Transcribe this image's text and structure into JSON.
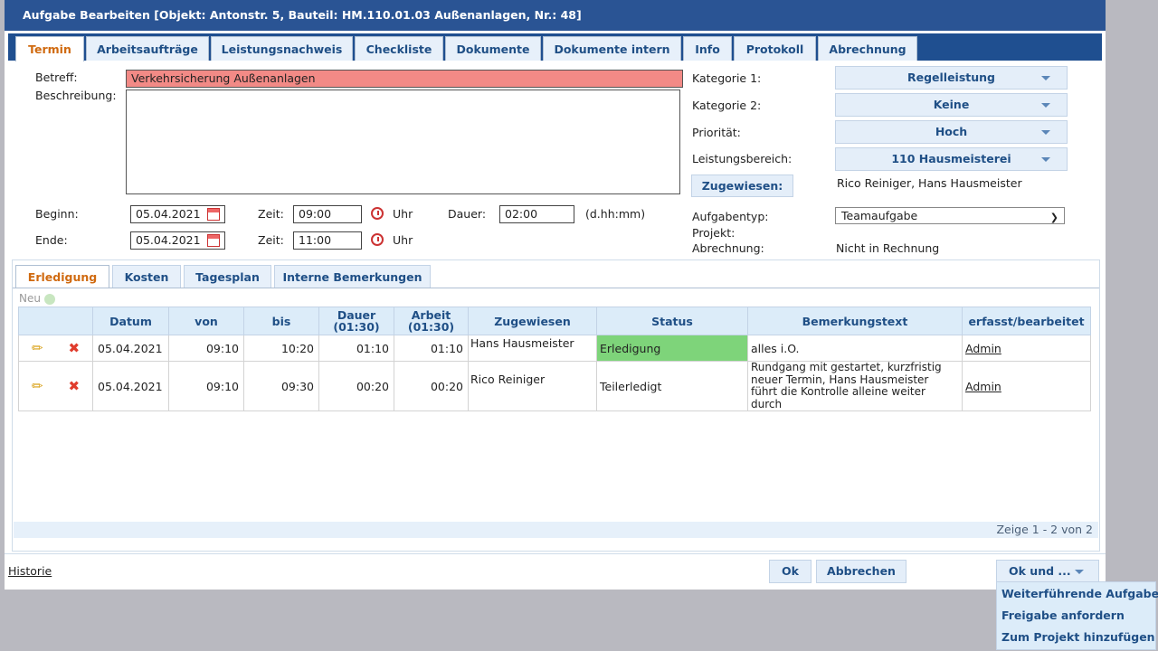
{
  "window": {
    "title": "Aufgabe Bearbeiten [Objekt: Antonstr. 5, Bauteil: HM.110.01.03 Außenanlagen, Nr.: 48]"
  },
  "tabs": [
    "Termin",
    "Arbeitsaufträge",
    "Leistungsnachweis",
    "Checkliste",
    "Dokumente",
    "Dokumente intern",
    "Info",
    "Protokoll",
    "Abrechnung"
  ],
  "form": {
    "betreff_label": "Betreff:",
    "betreff_value": "Verkehrsicherung Außenanlagen",
    "beschreibung_label": "Beschreibung:",
    "beginn_label": "Beginn:",
    "beginn_value": "05.04.2021",
    "ende_label": "Ende:",
    "ende_value": "05.04.2021",
    "zeit_label": "Zeit:",
    "zeit_begin": "09:00",
    "zeit_end": "11:00",
    "uhr_label": "Uhr",
    "dauer_label": "Dauer:",
    "dauer_value": "02:00",
    "dauer_hint": "(d.hh:mm)"
  },
  "right": {
    "kategorie1_label": "Kategorie 1:",
    "kategorie1_value": "Regelleistung",
    "kategorie2_label": "Kategorie 2:",
    "kategorie2_value": "Keine",
    "prioritaet_label": "Priorität:",
    "prioritaet_value": "Hoch",
    "leistungsbereich_label": "Leistungsbereich:",
    "leistungsbereich_value": "110 Hausmeisterei",
    "zugewiesen_button": "Zugewiesen:",
    "zugewiesen_value": "Rico Reiniger, Hans Hausmeister",
    "aufgabentyp_label": "Aufgabentyp:",
    "aufgabentyp_value": "Teamaufgabe",
    "projekt_label": "Projekt:",
    "abrechnung_label": "Abrechnung:",
    "abrechnung_value": "Nicht in Rechnung"
  },
  "subtabs": [
    "Erledigung",
    "Kosten",
    "Tagesplan",
    "Interne Bemerkungen"
  ],
  "grid": {
    "new_label": "Neu",
    "headers": {
      "datum": "Datum",
      "von": "von",
      "bis": "bis",
      "dauer": "Dauer",
      "dauer_sub": "(01:30)",
      "arbeit": "Arbeit",
      "arbeit_sub": "(01:30)",
      "zugewiesen": "Zugewiesen",
      "status": "Status",
      "bemerkung": "Bemerkungstext",
      "erfasst": "erfasst/bearbeitet"
    },
    "rows": [
      {
        "datum": "05.04.2021",
        "von": "09:10",
        "bis": "10:20",
        "dauer": "01:10",
        "arbeit": "01:10",
        "zugewiesen": "Hans Hausmeister",
        "status": "Erledigung",
        "bemerkung": "alles i.O.",
        "erfasst": "Admin"
      },
      {
        "datum": "05.04.2021",
        "von": "09:10",
        "bis": "09:30",
        "dauer": "00:20",
        "arbeit": "00:20",
        "zugewiesen": "Rico Reiniger",
        "status": "Teilerledigt",
        "bemerkung": "Rundgang mit gestartet, kurzfristig neuer Termin, Hans Hausmeister führt die Kontrolle alleine weiter durch",
        "erfasst": "Admin"
      }
    ],
    "pager": "Zeige 1 - 2 von 2"
  },
  "footer": {
    "historie": "Historie",
    "ok": "Ok",
    "abbrechen": "Abbrechen",
    "ok_und": "Ok und ..."
  },
  "menu": [
    "Weiterführende Aufgabe",
    "Freigabe anfordern",
    "Zum Projekt hinzufügen"
  ],
  "colors": {
    "titlebar": "#2a5494",
    "status_done": "#7ed47a",
    "betreff_bg": "#f28a86",
    "active_tab": "#d06a10"
  }
}
